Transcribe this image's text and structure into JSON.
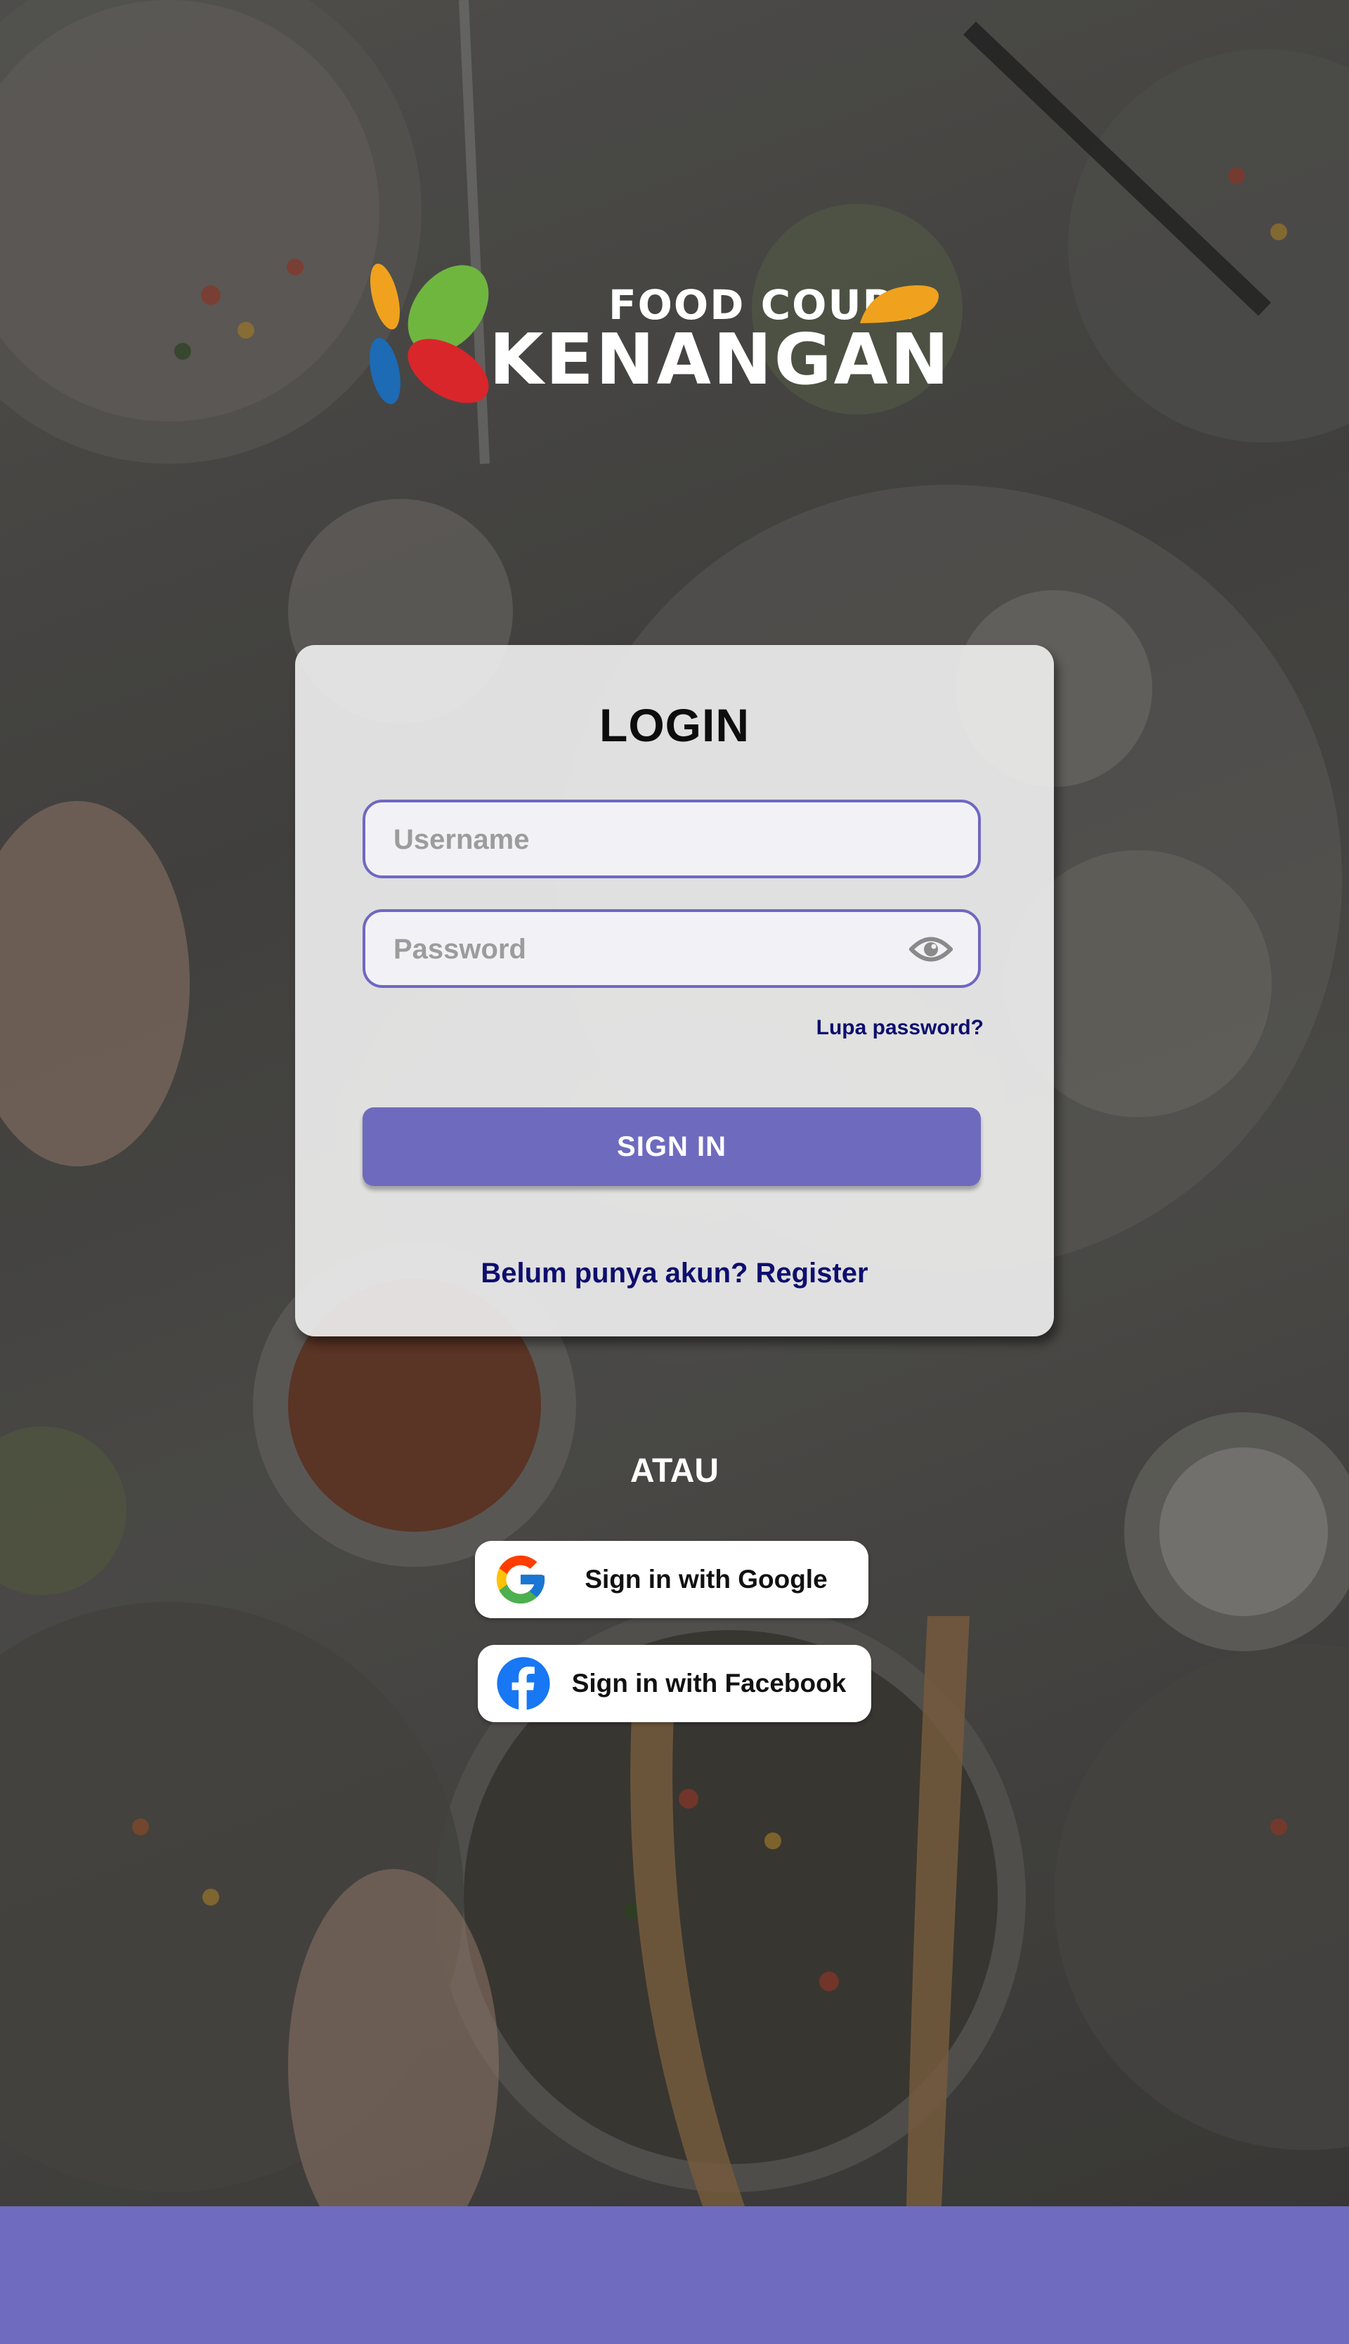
{
  "brand": {
    "top_text": "FOOD COURT",
    "main_text": "KENANGAN",
    "colors": {
      "leaf_green": "#6fb63f",
      "leaf_yellow": "#f0a21e",
      "leaf_red": "#d9262b",
      "leaf_blue": "#1d6ab5"
    }
  },
  "login": {
    "title": "LOGIN",
    "username_placeholder": "Username",
    "password_placeholder": "Password",
    "forgot_password": "Lupa password?",
    "sign_in_label": "SIGN IN",
    "register_text": "Belum punya akun? Register"
  },
  "alternatives": {
    "separator": "ATAU",
    "google_label": "Sign in with Google",
    "facebook_label": "Sign in with Facebook"
  },
  "icons": {
    "password_toggle": "eye-icon",
    "google": "google-icon",
    "facebook": "facebook-icon"
  },
  "theme": {
    "accent": "#6e6bbf",
    "link": "#0e0e6e"
  }
}
